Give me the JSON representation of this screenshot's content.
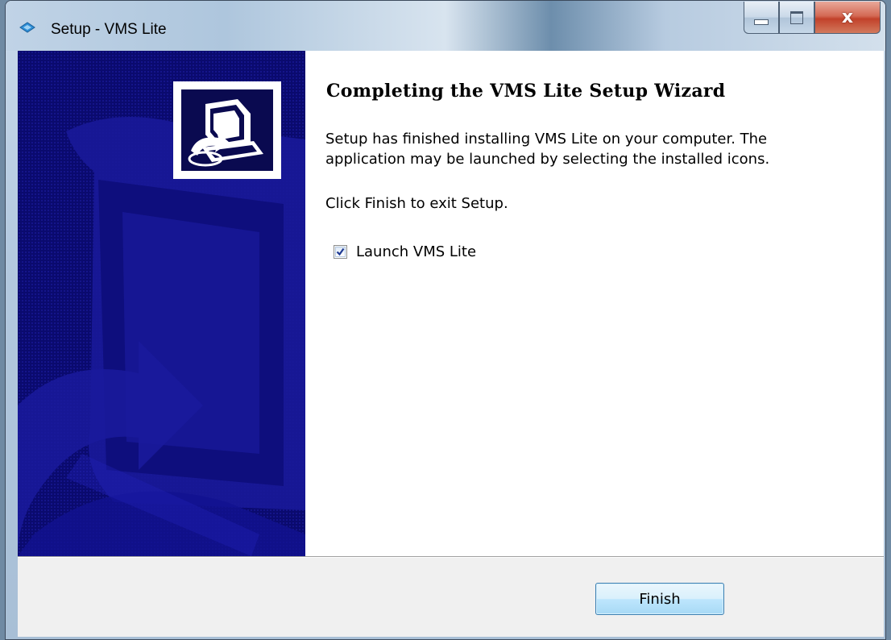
{
  "window": {
    "title": "Setup - VMS Lite",
    "app_icon": "setup-app-icon",
    "buttons": {
      "minimize_icon": "minimize-icon",
      "maximize_icon": "maximize-icon",
      "close_icon": "close-icon",
      "close_glyph": "x"
    }
  },
  "sidebar": {
    "image": "setup-wizard-banner",
    "logo_icon": "computer-install-icon"
  },
  "content": {
    "heading": "Completing the VMS Lite Setup Wizard",
    "description": "Setup has finished installing VMS Lite on your computer. The application may be launched by selecting the installed icons.",
    "hint": "Click Finish to exit Setup.",
    "launch_checkbox": {
      "label": "Launch VMS Lite",
      "checked": true
    }
  },
  "footer": {
    "finish_label": "Finish"
  },
  "colors": {
    "sidebar_background": "#0a0a6e",
    "accent_button": "#bee6fd",
    "close_button": "#c2412a"
  }
}
